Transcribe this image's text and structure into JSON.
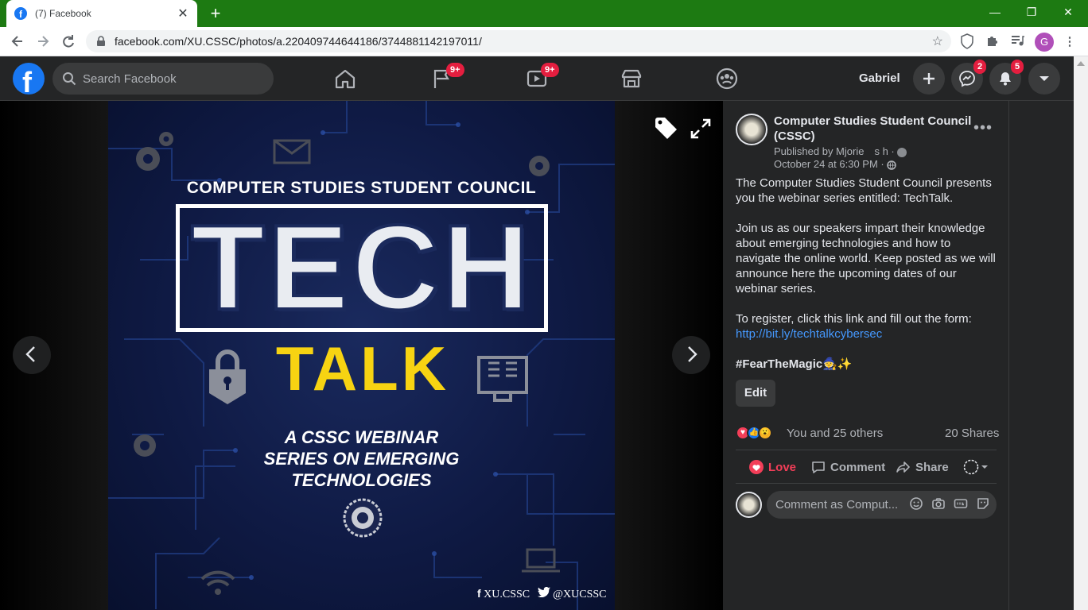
{
  "browser": {
    "tab_title": "(7) Facebook",
    "tab_close": "✕",
    "new_tab": "+",
    "url": "facebook.com/XU.CSSC/photos/a.220409744644186/3744881142197011/",
    "window": {
      "minimize": "—",
      "restore": "❐",
      "close": "✕"
    },
    "profile_initial": "G"
  },
  "fb_header": {
    "search_placeholder": "Search Facebook",
    "pages_badge": "9+",
    "watch_badge": "9+",
    "user_name": "Gabriel",
    "messenger_badge": "2",
    "notifications_badge": "5"
  },
  "photo": {
    "council": "COMPUTER STUDIES STUDENT COUNCIL",
    "tech": "TECH",
    "talk": "TALK",
    "subtitle_line1": "A CSSC WEBINAR",
    "subtitle_line2": "SERIES ON EMERGING",
    "subtitle_line3": "TECHNOLOGIES",
    "facebook_handle": "XU.CSSC",
    "twitter_handle": "@XUCSSC"
  },
  "post": {
    "page_name": "Computer Studies Student Council (CSSC)",
    "published_by": "Published by M​jorie     s  h ·",
    "date": "October 24 at 6:30 PM ·",
    "para1": "The Computer Studies Student Council presents you the webinar series entitled: TechTalk.",
    "para2": "Join us as our speakers impart their knowledge about emerging technologies and how to navigate the online world. Keep posted as we will announce here the upcoming dates of our webinar series.",
    "para3": "To register, click this link and fill out the form:",
    "link": "http://bit.ly/techtalkcybersec",
    "hashtag": "#FearTheMagic",
    "hashtag_emoji": "🧙✨",
    "edit_label": "Edit",
    "reactions_text": "You and 25 others",
    "shares_text": "20 Shares",
    "love_label": "Love",
    "comment_label": "Comment",
    "share_label": "Share",
    "comment_placeholder": "Comment as Comput..."
  },
  "colors": {
    "tabbar": "#1d7a12",
    "fb_blue": "#1877f2",
    "talk_yellow": "#f7d312",
    "love_red": "#f33e58",
    "link": "#4599ff"
  }
}
